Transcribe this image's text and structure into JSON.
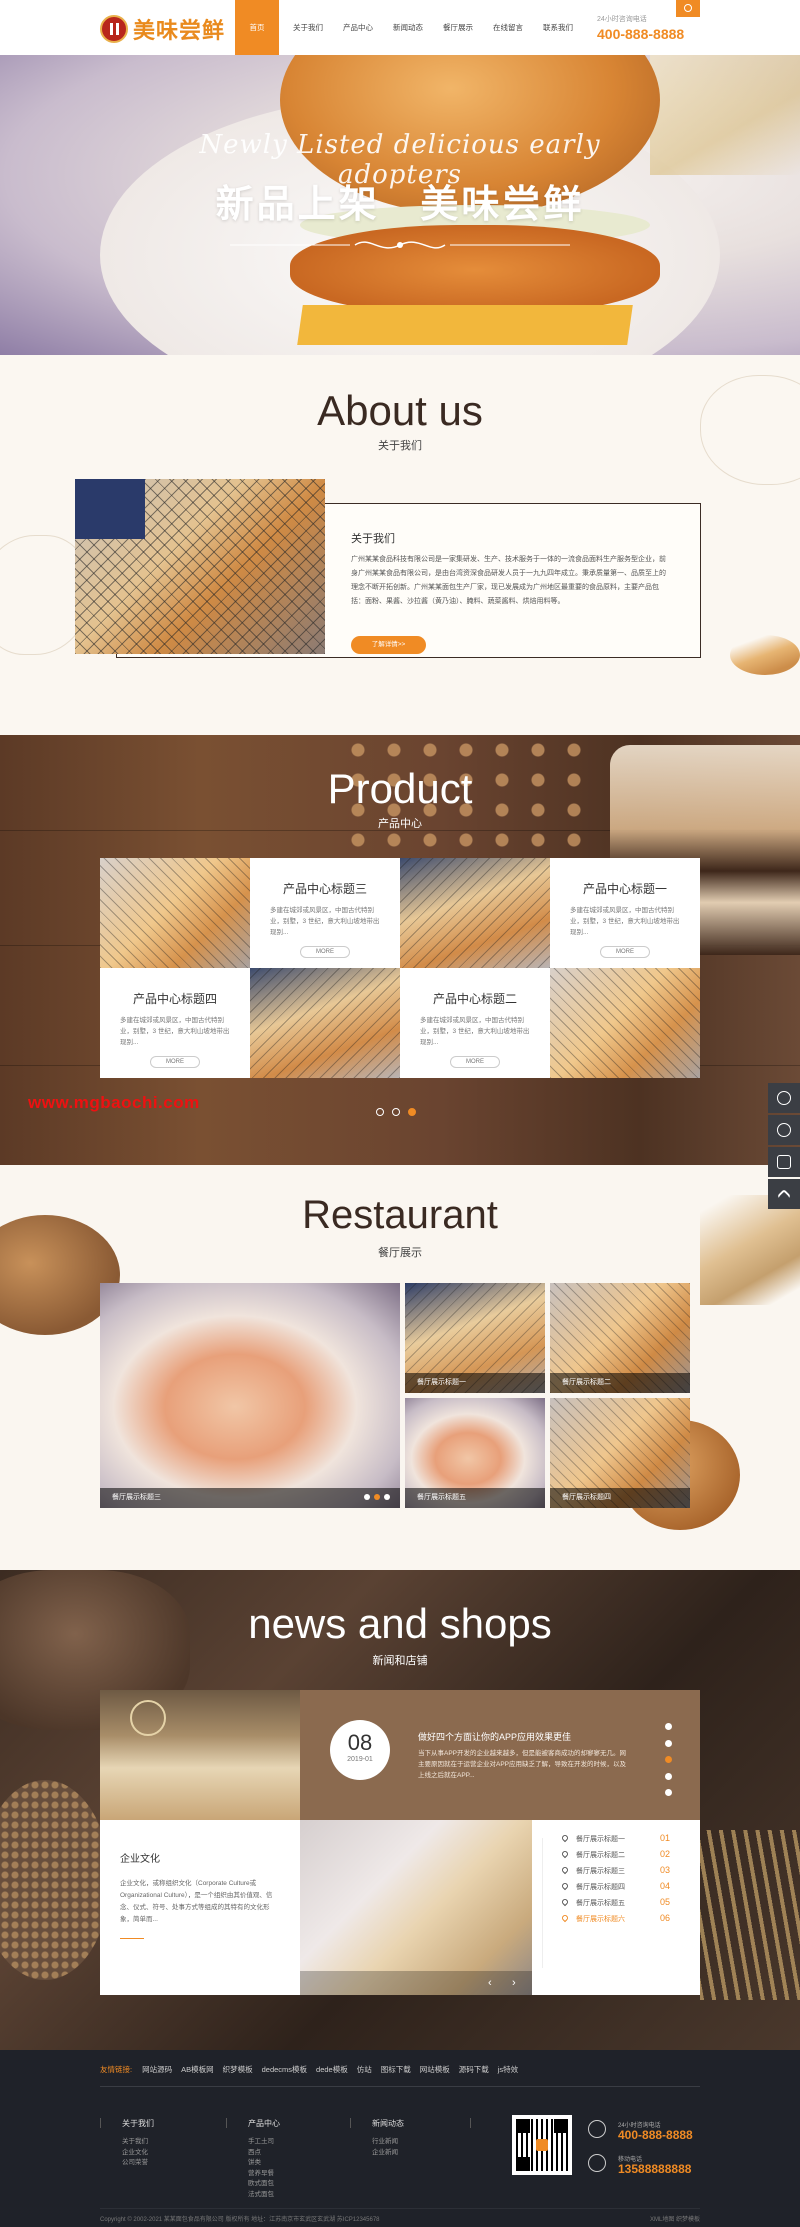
{
  "header": {
    "logo_text": "美味尝鲜",
    "nav": [
      "首页",
      "关于我们",
      "产品中心",
      "新闻动态",
      "餐厅展示",
      "在线留言",
      "联系我们"
    ],
    "hotline_label": "24小时咨询电话",
    "hotline_number": "400-888-8888"
  },
  "banner": {
    "script_text": "Newly Listed delicious early adopters",
    "title_left": "新品上架",
    "title_right": "美味尝鲜"
  },
  "about": {
    "title": "About us",
    "subtitle": "关于我们",
    "heading": "关于我们",
    "text": "广州某某食品科技有限公司是一家集研发、生产、技术服务于一体的一流食品面料生产服务型企业，前身广州某某食品有限公司，是由台湾资深食品研发人员于一九九四年成立。秉承质量第一、品质至上的理念不断开拓创新。广州某某面包生产厂家，现已发展成为广州地区最重要的食品原料，主要产品包括：面粉、果酱、沙拉酱（黄乃油）、腌料、蔬菜酱料、烘焙用料等。",
    "button": "了解详情>>"
  },
  "product": {
    "title": "Product",
    "subtitle": "产品中心",
    "cards": [
      {
        "title": "产品中心标题三",
        "desc": "多建在城郊或风景区，中国古代特别业，别墅，3 世纪，意大利山坡地带出现别...",
        "more": "MORE"
      },
      {
        "title": "产品中心标题一",
        "desc": "多建在城郊或风景区，中国古代特别业，别墅，3 世纪，意大利山坡地带出现别...",
        "more": "MORE"
      },
      {
        "title": "产品中心标题四",
        "desc": "多建在城郊或风景区，中国古代特别业，别墅，3 世纪，意大利山坡地带出现别...",
        "more": "MORE"
      },
      {
        "title": "产品中心标题二",
        "desc": "多建在城郊或风景区，中国古代特别业，别墅，3 世纪，意大利山坡地带出现别...",
        "more": "MORE"
      }
    ],
    "watermark": "www.mgbaochi.com"
  },
  "restaurant": {
    "title": "Restaurant",
    "subtitle": "餐厅展示",
    "captions": [
      "餐厅展示标题三",
      "餐厅展示标题一",
      "餐厅展示标题二",
      "餐厅展示标题五",
      "餐厅展示标题四"
    ]
  },
  "news": {
    "title": "news and shops",
    "subtitle": "新闻和店铺",
    "day": "08",
    "ym": "2019-01",
    "headline": "做好四个方面让你的APP应用效果更佳",
    "desc": "当下从事APP开发的企业越来越多，但是能被客商成功的却寥寥无几。网主要原因就在于运营企业对APP应用缺乏了解，导致在开发的时候，以及上线之后就在APP...",
    "company_title": "企业文化",
    "company_text": "企业文化，或称组织文化（Corporate Culture或Organizational Culture），是一个组织由其价值观、信念、仪式、符号、处事方式等组成的其特有的文化形象，简单而...",
    "list": [
      {
        "label": "餐厅展示标题一",
        "num": "01"
      },
      {
        "label": "餐厅展示标题二",
        "num": "02"
      },
      {
        "label": "餐厅展示标题三",
        "num": "03"
      },
      {
        "label": "餐厅展示标题四",
        "num": "04"
      },
      {
        "label": "餐厅展示标题五",
        "num": "05"
      },
      {
        "label": "餐厅展示标题六",
        "num": "06"
      }
    ]
  },
  "footer": {
    "links_lead": "友情链接:",
    "links": [
      "网站源码",
      "AB模板网",
      "织梦模板",
      "dedecms模板",
      "dede模板",
      "仿站",
      "图标下载",
      "网站模板",
      "源码下载",
      "js特效"
    ],
    "col1": {
      "title": "关于我们",
      "items": [
        "关于我们",
        "企业文化",
        "公司荣誉"
      ]
    },
    "col2": {
      "title": "产品中心",
      "items": [
        "手工土司",
        "西点",
        "饼类",
        "营养早餐",
        "欧式面包",
        "法式面包"
      ]
    },
    "col3": {
      "title": "新闻动态",
      "items": [
        "行业新闻",
        "企业新闻"
      ]
    },
    "phone_label": "24小时咨询电话",
    "phone": "400-888-8888",
    "mobile_label": "移动电话",
    "mobile": "13588888888",
    "copyright": "Copyright © 2002-2021 某某面包食品有限公司 版权所有    地址：江苏南京市玄武区玄武湖    苏ICP12345678",
    "right_links": "XML地图  织梦模板"
  },
  "colors": {
    "accent": "#f08b24",
    "footer_bg": "#1f2229",
    "dark_text": "#3a2a22"
  }
}
